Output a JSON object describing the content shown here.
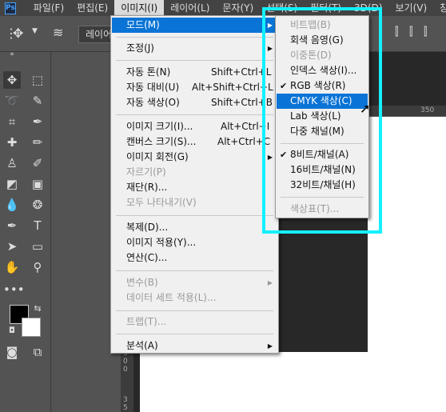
{
  "menubar": {
    "logo": "Ps",
    "items": [
      "파일(F)",
      "편집(E)",
      "이미지(I)",
      "레이어(L)",
      "문자(Y)",
      "선택(S)",
      "필터(T)",
      "3D(D)",
      "보기(V)",
      "창(W)"
    ],
    "active_index": 2
  },
  "options": {
    "layer_select": "레이어"
  },
  "image_menu": {
    "items": [
      {
        "label": "모드(M)",
        "highlighted": true,
        "submenu": true
      },
      {
        "label": "조정(J)",
        "submenu": true
      },
      {
        "label": "자동 톤(N)",
        "shortcut": "Shift+Ctrl+L"
      },
      {
        "label": "자동 대비(U)",
        "shortcut": "Alt+Shift+Ctrl+L"
      },
      {
        "label": "자동 색상(O)",
        "shortcut": "Shift+Ctrl+B"
      },
      {
        "label": "이미지 크기(I)...",
        "shortcut": "Alt+Ctrl+I"
      },
      {
        "label": "캔버스 크기(S)...",
        "shortcut": "Alt+Ctrl+C"
      },
      {
        "label": "이미지 회전(G)",
        "submenu": true
      },
      {
        "label": "자르기(P)",
        "disabled": true
      },
      {
        "label": "재단(R)..."
      },
      {
        "label": "모두 나타내기(V)",
        "disabled": true
      },
      {
        "label": "복제(D)..."
      },
      {
        "label": "이미지 적용(Y)..."
      },
      {
        "label": "연산(C)..."
      },
      {
        "label": "변수(B)",
        "disabled": true,
        "submenu": true
      },
      {
        "label": "데이터 세트 적용(L)...",
        "disabled": true
      },
      {
        "label": "트랩(T)...",
        "disabled": true
      },
      {
        "label": "분석(A)",
        "submenu": true
      }
    ]
  },
  "mode_menu": {
    "items": [
      {
        "label": "비트맵(B)",
        "disabled": true
      },
      {
        "label": "회색 음영(G)"
      },
      {
        "label": "이중톤(D)",
        "disabled": true
      },
      {
        "label": "인덱스 색상(I)..."
      },
      {
        "label": "RGB 색상(R)",
        "checked": true
      },
      {
        "label": "CMYK 색상(C)",
        "highlighted": true
      },
      {
        "label": "Lab 색상(L)"
      },
      {
        "label": "다중 채널(M)"
      },
      {
        "label": "8비트/채널(A)",
        "checked": true
      },
      {
        "label": "16비트/채널(N)"
      },
      {
        "label": "32비트/채널(H)"
      },
      {
        "label": "색상표(T)...",
        "disabled": true
      }
    ]
  },
  "ruler": {
    "top_label": "350",
    "left_label_1": "300",
    "left_label_2": "35"
  },
  "colors": {
    "highlight": "#0a74d6",
    "annotation": "#14f0ff"
  }
}
